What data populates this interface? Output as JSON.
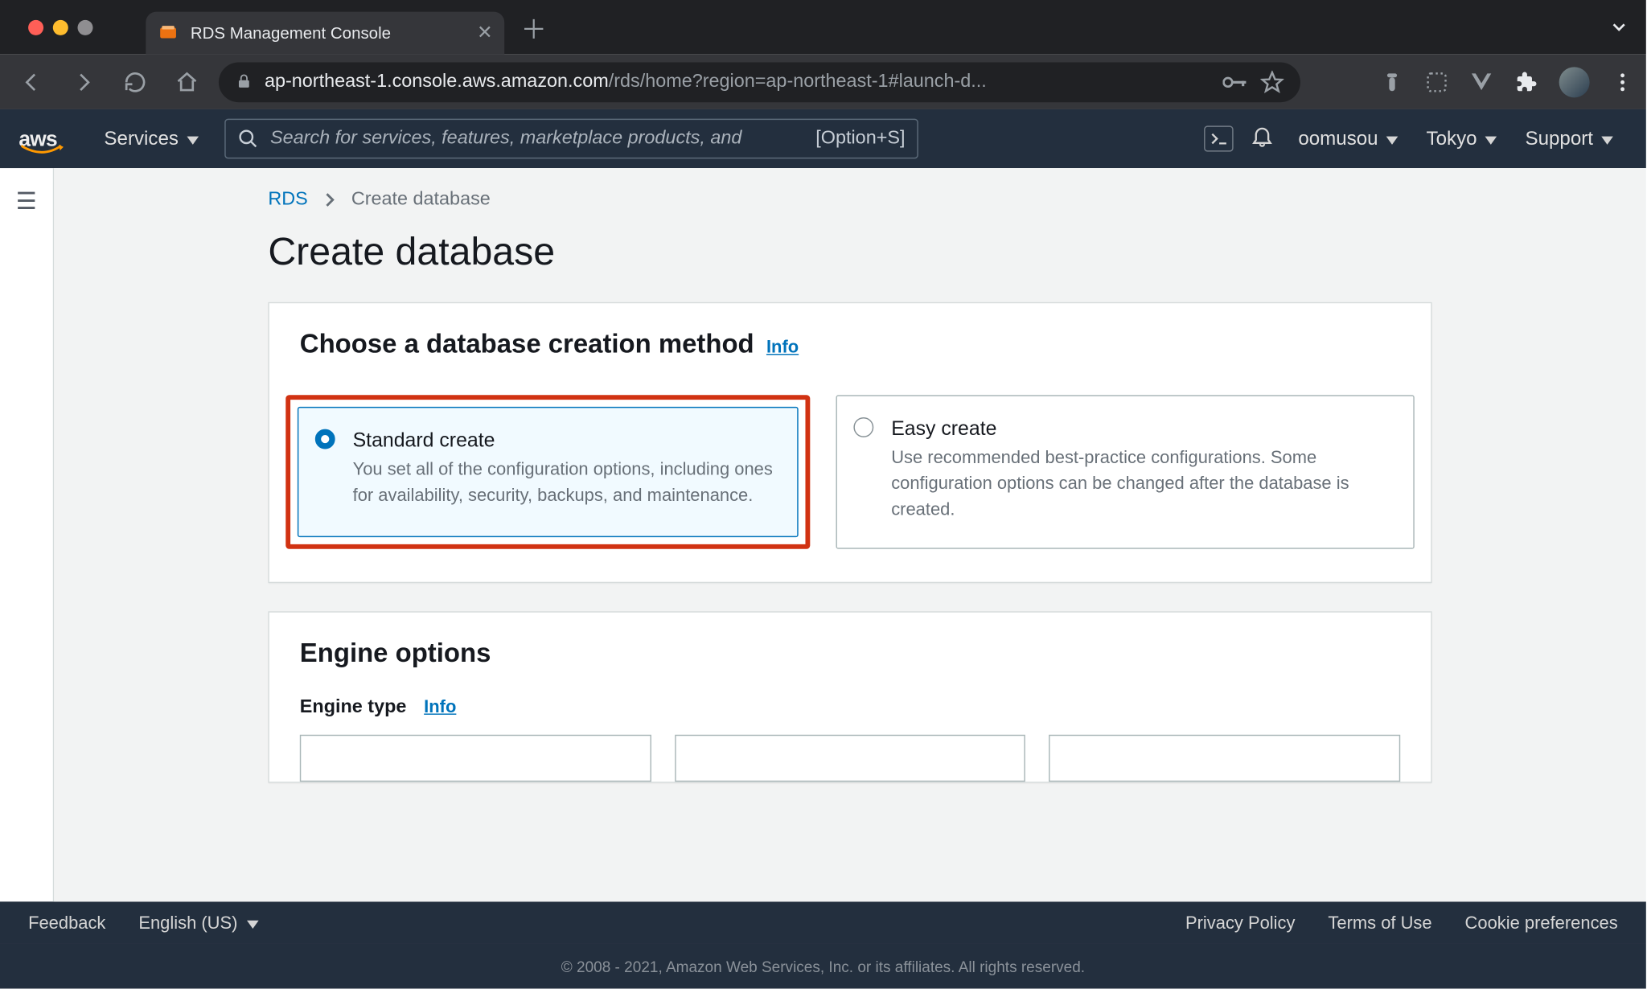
{
  "browser": {
    "tab_title": "RDS Management Console",
    "url_display_host": "ap-northeast-1.console.aws.amazon.com",
    "url_display_path": "/rds/home?region=ap-northeast-1#launch-d..."
  },
  "aws_nav": {
    "services": "Services",
    "search_placeholder": "Search for services, features, marketplace products, and",
    "search_hint": "[Option+S]",
    "account": "oomusou",
    "region": "Tokyo",
    "support": "Support"
  },
  "breadcrumb": {
    "root": "RDS",
    "current": "Create database"
  },
  "page": {
    "title": "Create database",
    "panel1": {
      "heading": "Choose a database creation method",
      "info": "Info",
      "options": [
        {
          "title": "Standard create",
          "desc": "You set all of the configuration options, including ones for availability, security, backups, and maintenance.",
          "selected": true
        },
        {
          "title": "Easy create",
          "desc": "Use recommended best-practice configurations. Some configuration options can be changed after the database is created.",
          "selected": false
        }
      ]
    },
    "panel2": {
      "heading": "Engine options",
      "subheading": "Engine type",
      "info": "Info"
    }
  },
  "footer": {
    "feedback": "Feedback",
    "language": "English (US)",
    "links": [
      "Privacy Policy",
      "Terms of Use",
      "Cookie preferences"
    ],
    "copyright": "© 2008 - 2021, Amazon Web Services, Inc. or its affiliates. All rights reserved."
  }
}
